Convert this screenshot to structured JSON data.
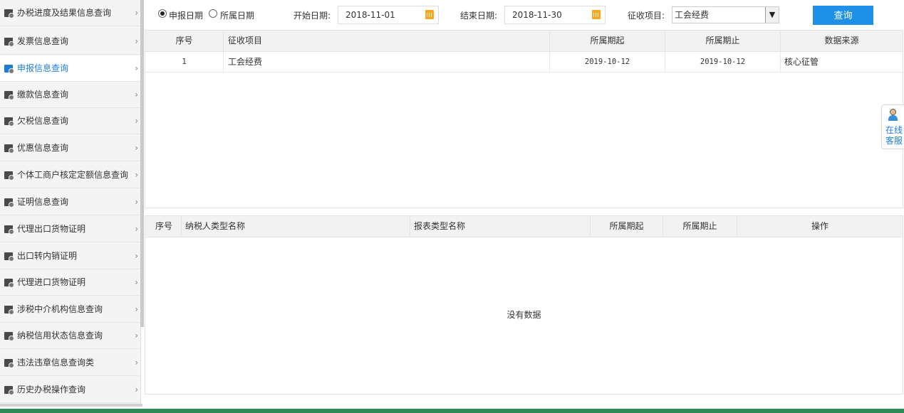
{
  "sidebar": {
    "items": [
      {
        "label": "办税进度及结果信息查询",
        "icon": "progress-icon",
        "active": false
      },
      {
        "label": "发票信息查询",
        "icon": "invoice-icon",
        "active": false
      },
      {
        "label": "申报信息查询",
        "icon": "declaration-icon",
        "active": true
      },
      {
        "label": "缴款信息查询",
        "icon": "payment-icon",
        "active": false
      },
      {
        "label": "欠税信息查询",
        "icon": "arrears-icon",
        "active": false
      },
      {
        "label": "优惠信息查询",
        "icon": "discount-icon",
        "active": false
      },
      {
        "label": "个体工商户核定定额信息查询",
        "icon": "quota-icon",
        "active": false
      },
      {
        "label": "证明信息查询",
        "icon": "certificate-icon",
        "active": false
      },
      {
        "label": "代理出口货物证明",
        "icon": "export-icon",
        "active": false
      },
      {
        "label": "出口转内销证明",
        "icon": "domestic-sale-icon",
        "active": false
      },
      {
        "label": "代理进口货物证明",
        "icon": "import-icon",
        "active": false
      },
      {
        "label": "涉税中介机构信息查询",
        "icon": "agency-icon",
        "active": false
      },
      {
        "label": "纳税信用状态信息查询",
        "icon": "credit-icon",
        "active": false
      },
      {
        "label": "违法违章信息查询类",
        "icon": "violation-icon",
        "active": false
      },
      {
        "label": "历史办税操作查询",
        "icon": "history-icon",
        "active": false
      }
    ],
    "chevron": "›"
  },
  "filter": {
    "radio_declare_date": "申报日期",
    "radio_period_date": "所属日期",
    "start_date_label": "开始日期:",
    "start_date_value": "2018-11-01",
    "end_date_label": "结束日期:",
    "end_date_value": "2018-11-30",
    "item_label": "征收项目:",
    "item_value": "工会经费",
    "query_button": "查询"
  },
  "table1": {
    "headers": [
      "序号",
      "征收项目",
      "所属期起",
      "所属期止",
      "数据来源"
    ],
    "rows": [
      [
        "1",
        "工会经费",
        "2019-10-12",
        "2019-10-12",
        "核心征管"
      ]
    ]
  },
  "table2": {
    "headers": [
      "序号",
      "纳税人类型名称",
      "报表类型名称",
      "所属期起",
      "所属期止",
      "操作"
    ],
    "empty_text": "没有数据"
  },
  "online_service": {
    "text": "在线客服"
  },
  "colors": {
    "accent": "#1e7ed6",
    "button": "#1e90e8",
    "calendar": "#f5a623"
  }
}
